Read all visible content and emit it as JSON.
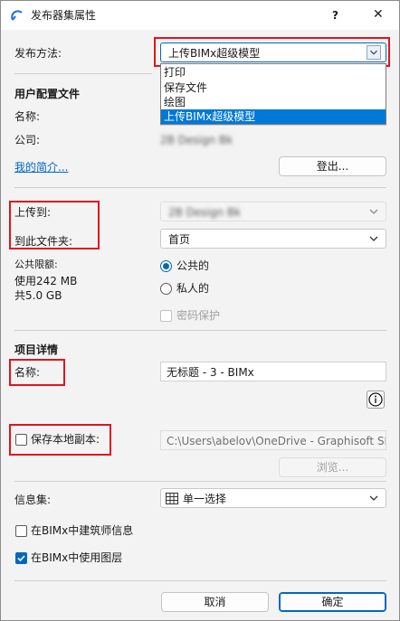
{
  "window": {
    "title": "发布器集属性",
    "help_label": "?",
    "close_label": "✕"
  },
  "publish": {
    "label": "发布方法:",
    "selected": "上传BIMx超级模型",
    "options": [
      "打印",
      "保存文件",
      "绘图",
      "上传BIMx超级模型"
    ]
  },
  "profile": {
    "heading": "用户配置文件",
    "name_label": "名称:",
    "name_value": "",
    "company_label": "公司:",
    "company_value": "2B Design Bk",
    "my_profile_link": "我的简介...",
    "logout_button": "登出..."
  },
  "upload": {
    "upload_to_label": "上传到:",
    "upload_to_value": "2B Design Bk",
    "folder_label": "到此文件夹:",
    "folder_value": "首页",
    "quota_label": "公共限额:",
    "used_text": "使用242 MB",
    "total_text": "共5.0 GB",
    "public_label": "公共的",
    "private_label": "私人的",
    "password_label": "密码保护"
  },
  "project": {
    "heading": "项目详情",
    "name_label": "名称:",
    "name_value": "无标题 - 3 - BIMx",
    "info_icon_glyph": "i"
  },
  "local_copy": {
    "label": "保存本地副本:",
    "path": "C:\\Users\\abelov\\OneDrive - Graphisoft SE",
    "browse_button": "浏览..."
  },
  "info_set": {
    "label": "信息集:",
    "value": "单一选择"
  },
  "options": {
    "architect_info": "在BIMx中建筑师信息",
    "use_layers": "在BIMx中使用图层"
  },
  "footer": {
    "cancel_button": "取消",
    "ok_button": "确定"
  },
  "colors": {
    "accent": "#0067c0",
    "highlight": "#e0141e",
    "selection": "#0078d7"
  }
}
